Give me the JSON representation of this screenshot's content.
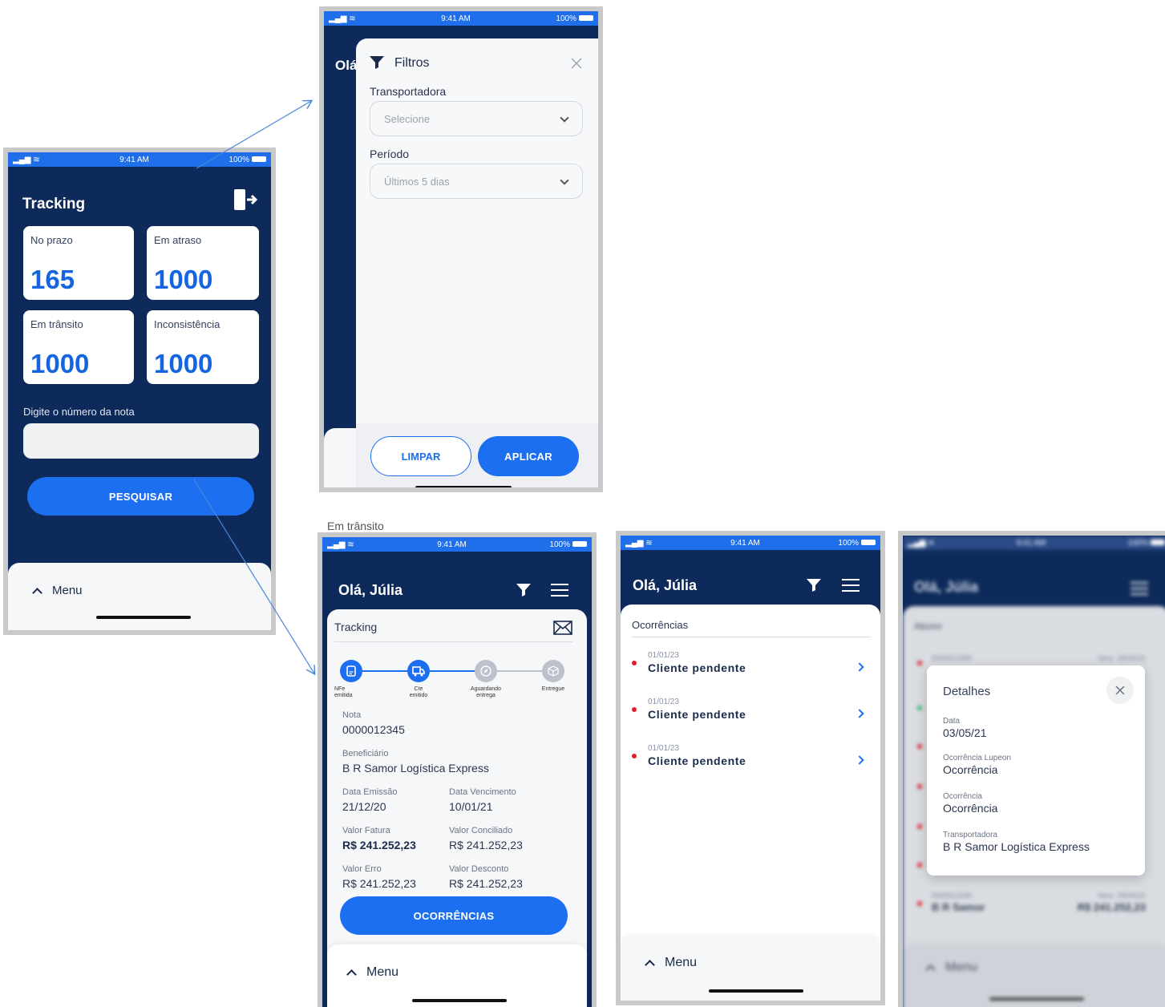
{
  "status": {
    "time": "9:41 AM",
    "battery": "100%"
  },
  "screen1": {
    "title": "Tracking",
    "cards": [
      {
        "label": "No prazo",
        "value": "165"
      },
      {
        "label": "Em atraso",
        "value": "1000"
      },
      {
        "label": "Em trânsito",
        "value": "1000"
      },
      {
        "label": "Inconsistência",
        "value": "1000"
      }
    ],
    "search_label": "Digite o número da nota",
    "search_placeholder": "",
    "search_button": "PESQUISAR",
    "menu_label": "Menu"
  },
  "screen2": {
    "bg_greeting": "Olá",
    "title": "Filtros",
    "transportadora_label": "Transportadora",
    "transportadora_value": "Selecione",
    "periodo_label": "Período",
    "periodo_value": "Últimos 5 dias",
    "clear_button": "LIMPAR",
    "apply_button": "APLICAR"
  },
  "screen3": {
    "header_peek": "Em trânsito",
    "greeting": "Olá, Júlia",
    "section_title": "Tracking",
    "steps": [
      {
        "label_1": "NFe",
        "label_2": "emitida"
      },
      {
        "label_1": "Cte",
        "label_2": "emitido"
      },
      {
        "label_1": "Aguardando",
        "label_2": "entrega"
      },
      {
        "label_1": "Entregue",
        "label_2": ""
      }
    ],
    "nota_label": "Nota",
    "nota_value": "0000012345",
    "beneficiario_label": "Beneficiário",
    "beneficiario_value": "B R Samor Logística Express",
    "data_emissao_label": "Data Emissão",
    "data_emissao_value": "21/12/20",
    "data_vencimento_label": "Data Vencimento",
    "data_vencimento_value": "10/01/21",
    "valor_fatura_label": "Valor Fatura",
    "valor_fatura_value": "R$ 241.252,23",
    "valor_conciliado_label": "Valor Conciliado",
    "valor_conciliado_value": "R$ 241.252,23",
    "valor_erro_label": "Valor Erro",
    "valor_erro_value": "R$ 241.252,23",
    "valor_desconto_label": "Valor Desconto",
    "valor_desconto_value": "R$ 241.252,23",
    "ocorrencias_button": "OCORRÊNCIAS",
    "menu_label": "Menu"
  },
  "screen4": {
    "greeting": "Olá, Júlia",
    "section_title": "Ocorrências",
    "items": [
      {
        "date": "01/01/23",
        "text": "Cliente pendente"
      },
      {
        "date": "01/01/23",
        "text": "Cliente pendente"
      },
      {
        "date": "01/01/23",
        "text": "Cliente pendente"
      }
    ],
    "menu_label": "Menu"
  },
  "screen5": {
    "greeting": "Olá, Júlia",
    "section_title": "Abono",
    "bg_note": "0000012345",
    "bg_name": "B R Samor",
    "bg_due": "Venc. 05/04/21",
    "bg_value": "R$ 241.252,23",
    "menu_label": "Menu",
    "modal": {
      "title": "Detalhes",
      "data_label": "Data",
      "data_value": "03/05/21",
      "ocorrencia_lupeon_label": "Ocorrência Lupeon",
      "ocorrencia_lupeon_value": "Ocorrência",
      "ocorrencia_label": "Ocorrência",
      "ocorrencia_value": "Ocorrência",
      "transportadora_label": "Transportadora",
      "transportadora_value": "B R Samor Logística Express"
    }
  },
  "colors": {
    "navy": "#0e2a5a",
    "accent": "#1b6ff0",
    "error": "#e0202a",
    "success": "#2bb673"
  }
}
